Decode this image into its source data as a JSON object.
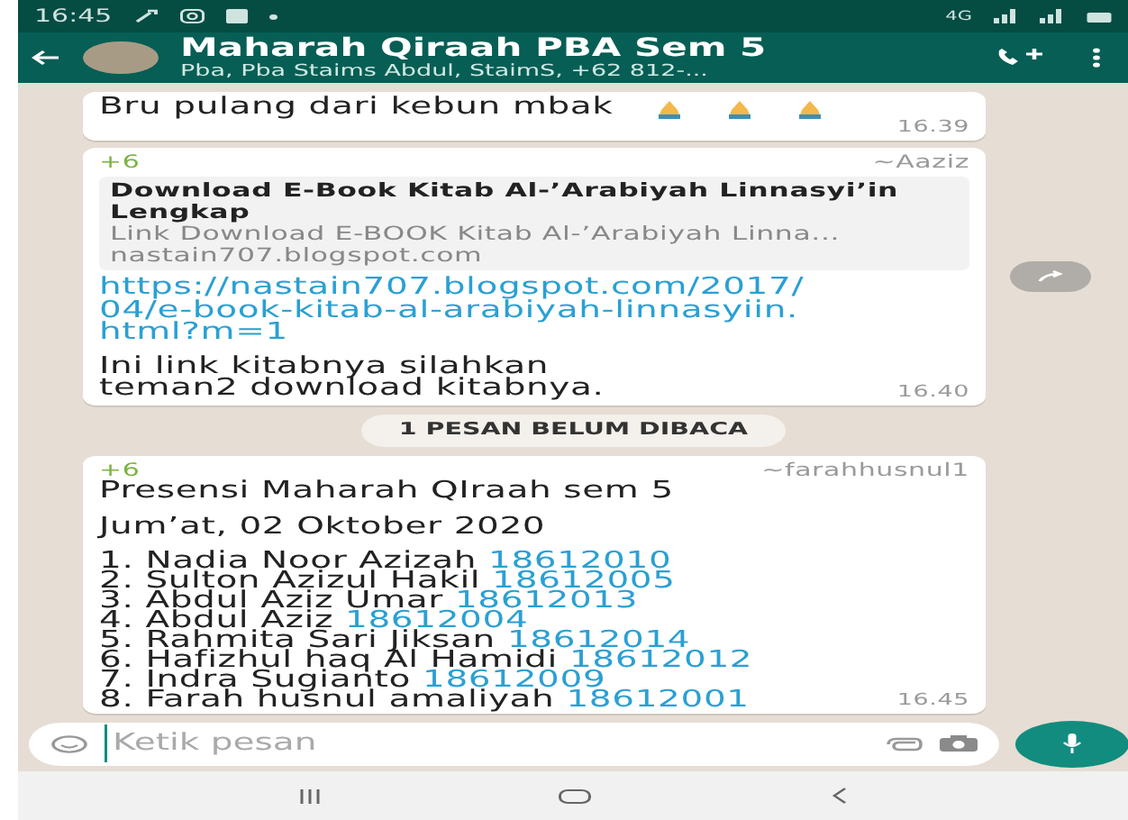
{
  "status_bar": {
    "time": "16:45",
    "network": "4G"
  },
  "header": {
    "title": "Maharah Qiraah PBA Sem 5",
    "subtitle": "Pba, Pba Staims Abdul, StaimS, +62 812-..."
  },
  "messages": [
    {
      "kind": "text",
      "text": "Bru pulang dari kebun mbak",
      "time": "16.39"
    },
    {
      "kind": "link",
      "sender_phone": "+6",
      "sender": "~Aaziz",
      "preview": {
        "title": "Download E-Book Kitab Al-’Arabiyah Linnasyi’in Lengkap",
        "description": "Link Download E-BOOK Kitab Al-’Arabiyah Linna...",
        "domain": "nastain707.blogspot.com"
      },
      "url": "https://nastain707.blogspot.com/2017/04/e-book-kitab-al-arabiyah-linnasyiin.html?m=1",
      "text": "Ini link kitabnya silahkan teman2 download kitabnya.",
      "time": "16.40",
      "forward": true
    },
    {
      "kind": "unread",
      "label": "1 PESAN BELUM DIBACA"
    },
    {
      "kind": "list",
      "sender_phone": "+6",
      "sender": "~farahhusnul1",
      "title": "Presensi Maharah QIraah sem 5",
      "date": "Jum’at, 02 Oktober 2020",
      "entries": [
        {
          "name": "1. Nadia Noor Azizah",
          "number": "18612010"
        },
        {
          "name": "2. Sulton Azizul Hakil",
          "number": "18612005"
        },
        {
          "name": "3. Abdul Aziz Umar",
          "number": "18612013"
        },
        {
          "name": "4. Abdul Aziz",
          "number": "18612004"
        },
        {
          "name": "5. Rahmita Sari Jiksan",
          "number": "18612014"
        },
        {
          "name": "6. Hafizhul haq Al Hamidi",
          "number": "18612012"
        },
        {
          "name": "7. Indra Sugianto",
          "number": "18612009"
        },
        {
          "name": "8. Farah husnul amaliyah",
          "number": "18612001"
        }
      ],
      "time": "16.45"
    }
  ],
  "composer": {
    "placeholder": "Ketik pesan"
  }
}
